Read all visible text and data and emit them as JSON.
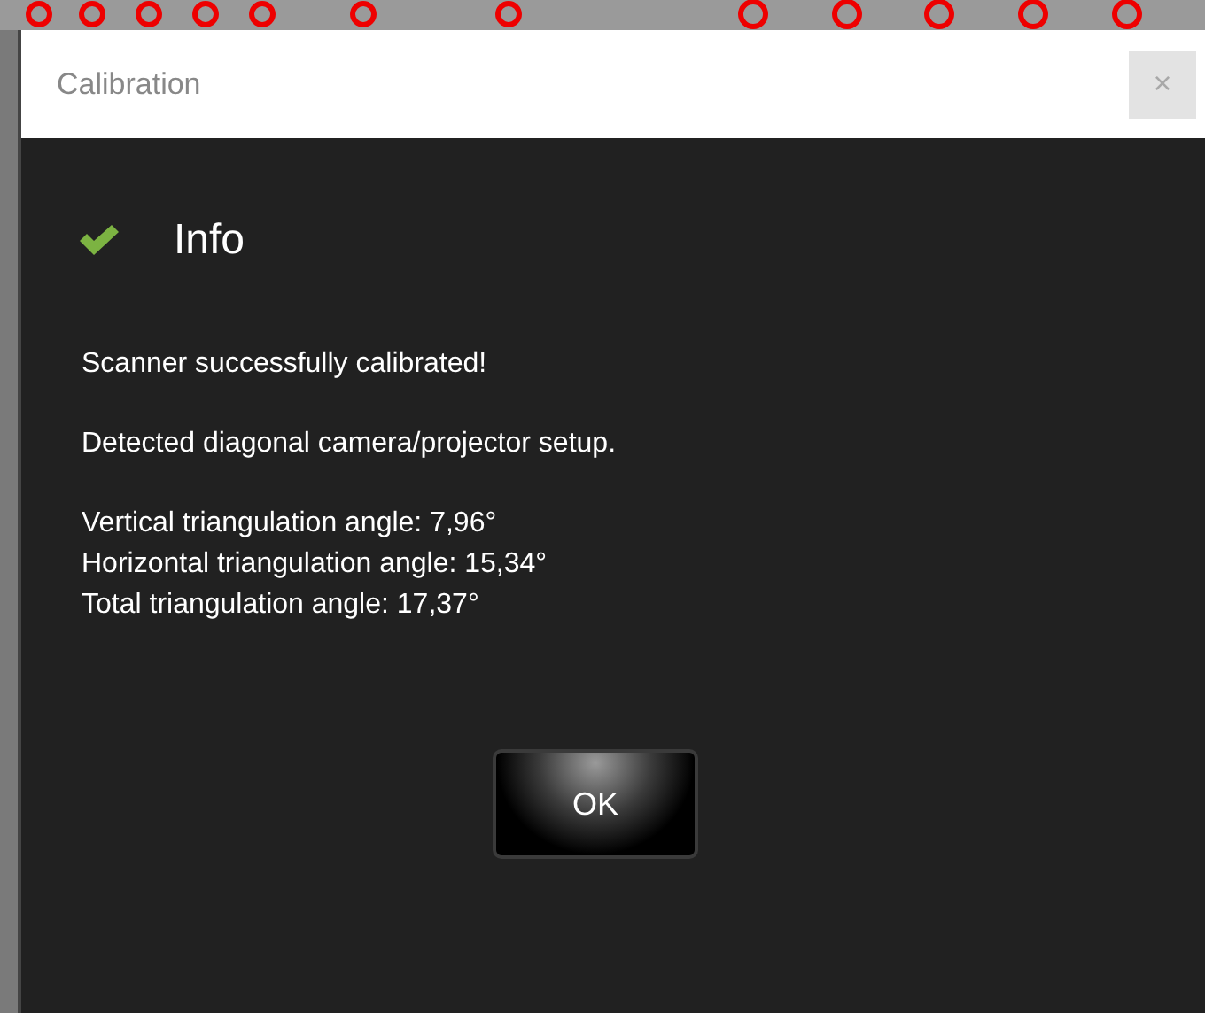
{
  "window": {
    "title": "Calibration",
    "close_button": "×"
  },
  "header": {
    "title": "Info"
  },
  "messages": [
    [
      "Scanner successfully calibrated!"
    ],
    [
      "Detected diagonal camera/projector setup."
    ],
    [
      "Vertical triangulation angle: 7,96°",
      "Horizontal triangulation angle: 15,34°",
      "Total triangulation angle: 17,37°"
    ]
  ],
  "buttons": [
    "OK"
  ]
}
